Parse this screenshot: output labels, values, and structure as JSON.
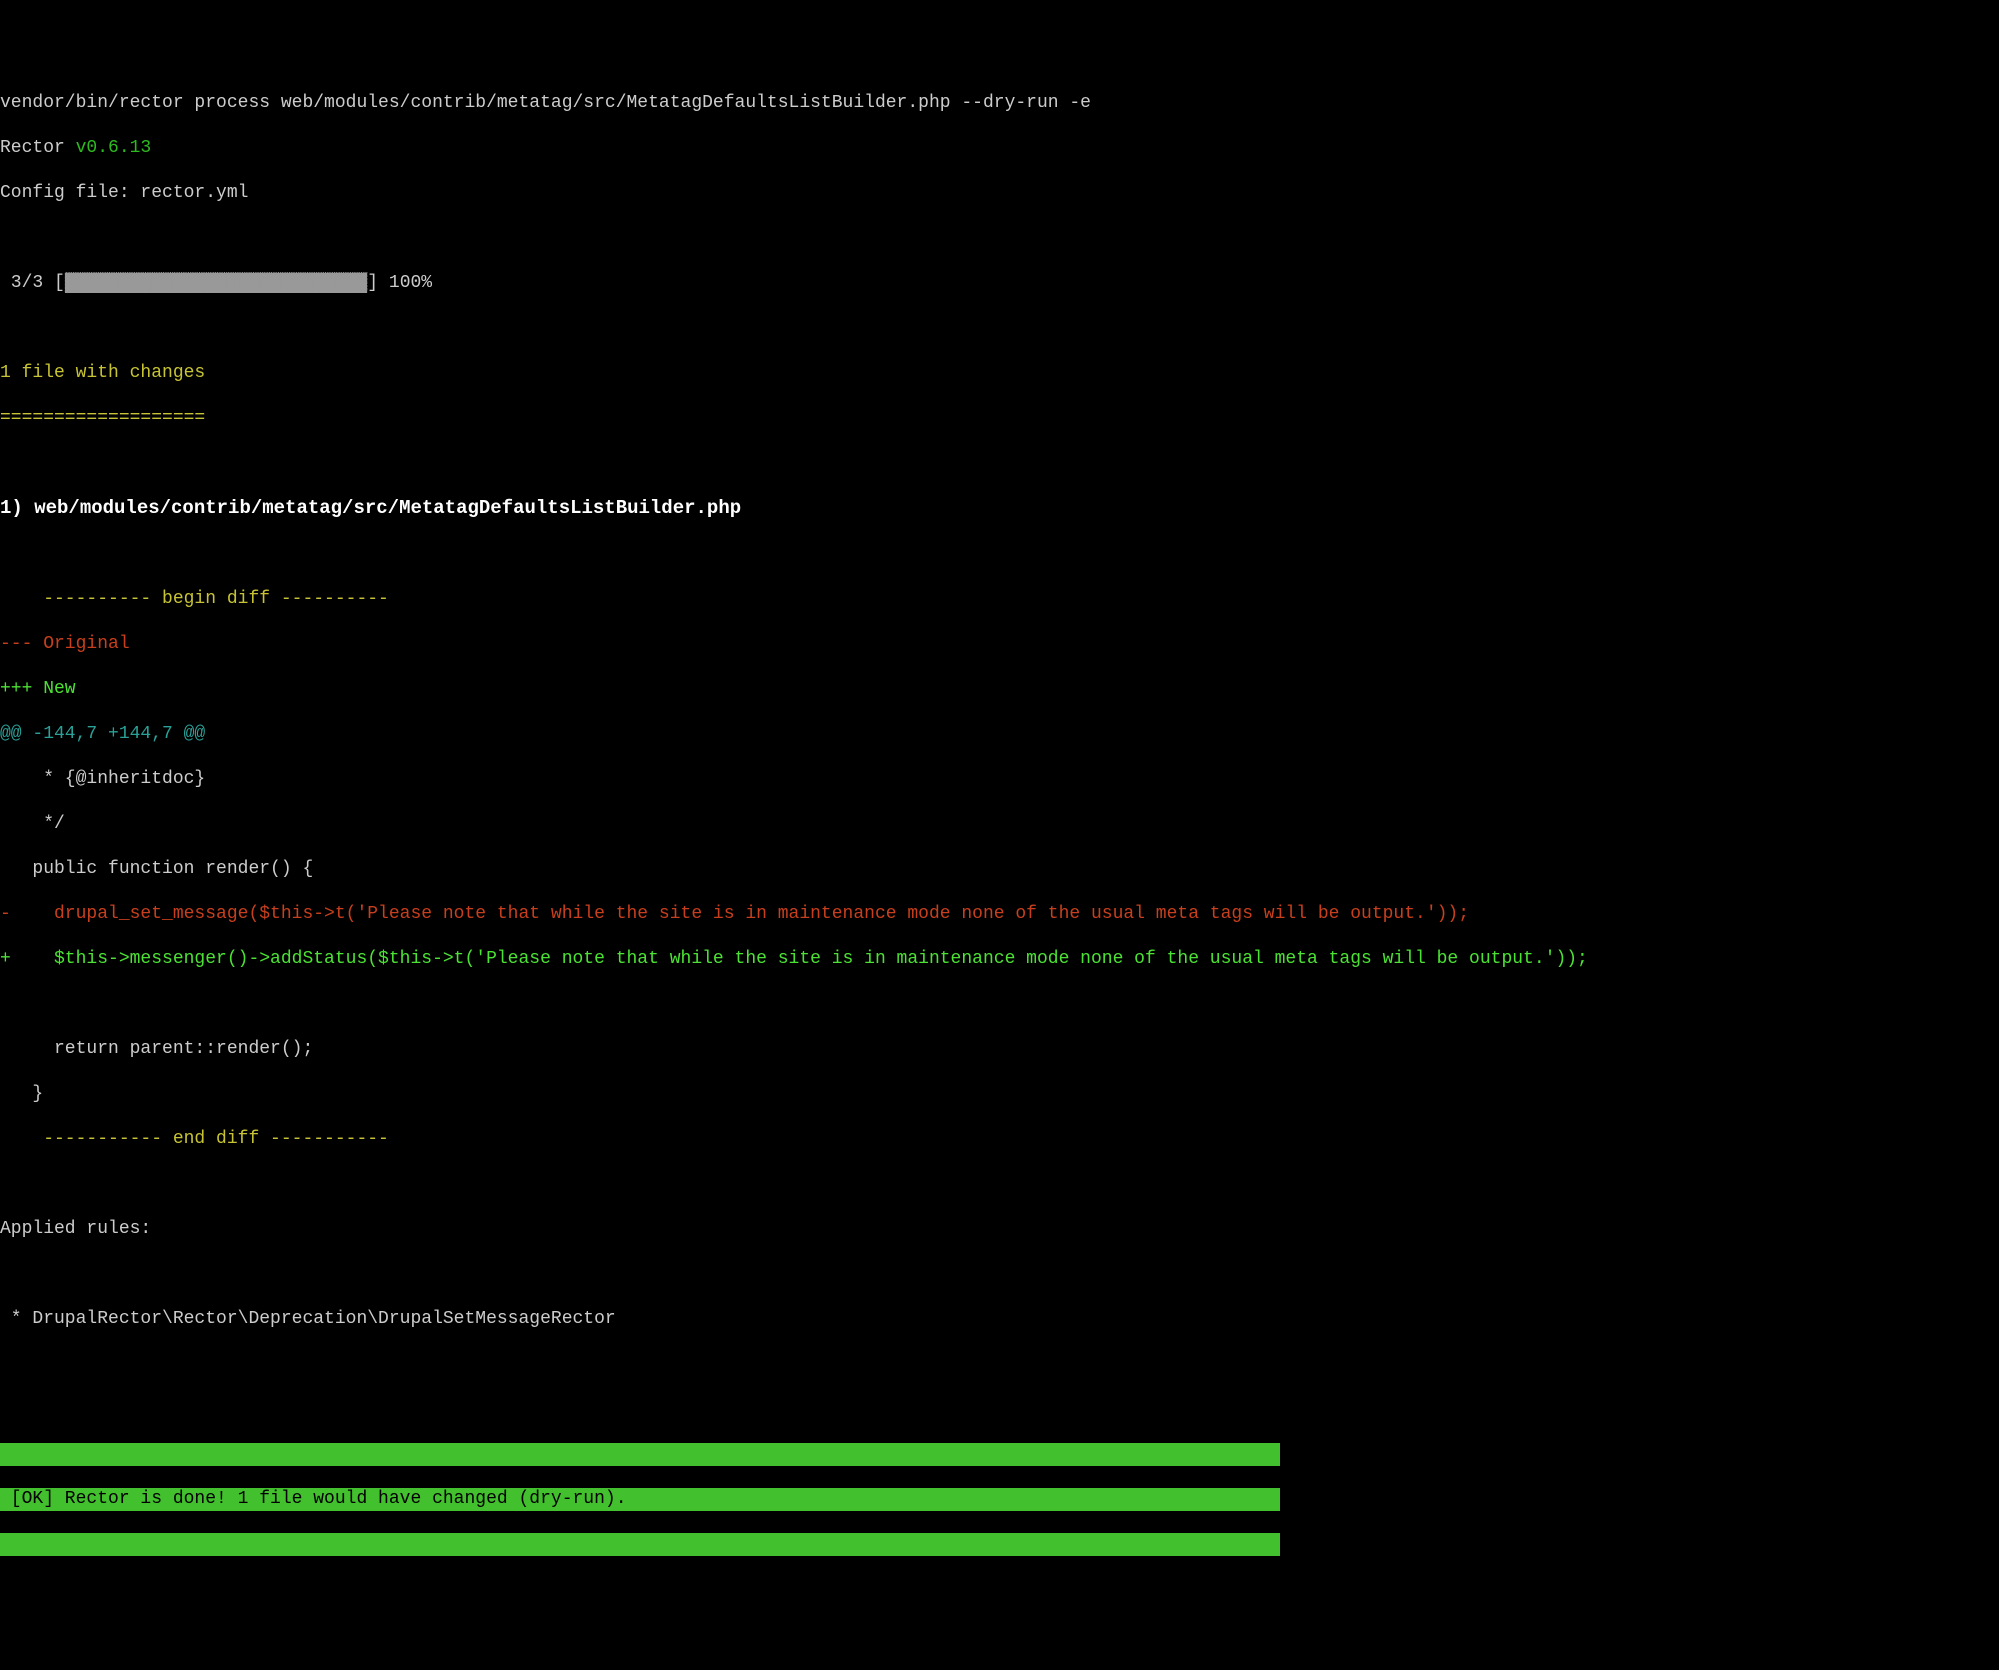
{
  "command": "vendor/bin/rector process web/modules/contrib/metatag/src/MetatagDefaultsListBuilder.php --dry-run -e",
  "rector_label": "Rector ",
  "rector_version": "v0.6.13",
  "config_line": "Config file: rector.yml",
  "progress": {
    "count": " 3/3 ",
    "bar_open": "[",
    "bar_fill": "▓▓▓▓▓▓▓▓▓▓▓▓▓▓▓▓▓▓▓▓▓▓▓▓▓▓▓▓",
    "bar_close": "]",
    "percent": " 100%"
  },
  "changes_header": "1 file with changes",
  "changes_divider": "===================",
  "file_entry": "1) web/modules/contrib/metatag/src/MetatagDefaultsListBuilder.php",
  "diff": {
    "begin": "    ---------- begin diff ----------",
    "original": "--- Original",
    "new": "+++ New",
    "hunk": "@@ -144,7 +144,7 @@",
    "ctx1": "    * {@inheritdoc}",
    "ctx2": "    */",
    "ctx3": "   public function render() {",
    "removed": "-    drupal_set_message($this->t('Please note that while the site is in maintenance mode none of the usual meta tags will be output.'));",
    "added": "+    $this->messenger()->addStatus($this->t('Please note that while the site is in maintenance mode none of the usual meta tags will be output.'));",
    "blank": " ",
    "ctx4": "     return parent::render();",
    "ctx5": "   }",
    "end": "    ----------- end diff -----------"
  },
  "applied_rules_label": "Applied rules:",
  "applied_rule": " * DrupalRector\\Rector\\Deprecation\\DrupalSetMessageRector",
  "ok_blank": "                                                                                                                                ",
  "ok_message": " [OK] Rector is done! 1 file would have changed (dry-run).                                                                      "
}
